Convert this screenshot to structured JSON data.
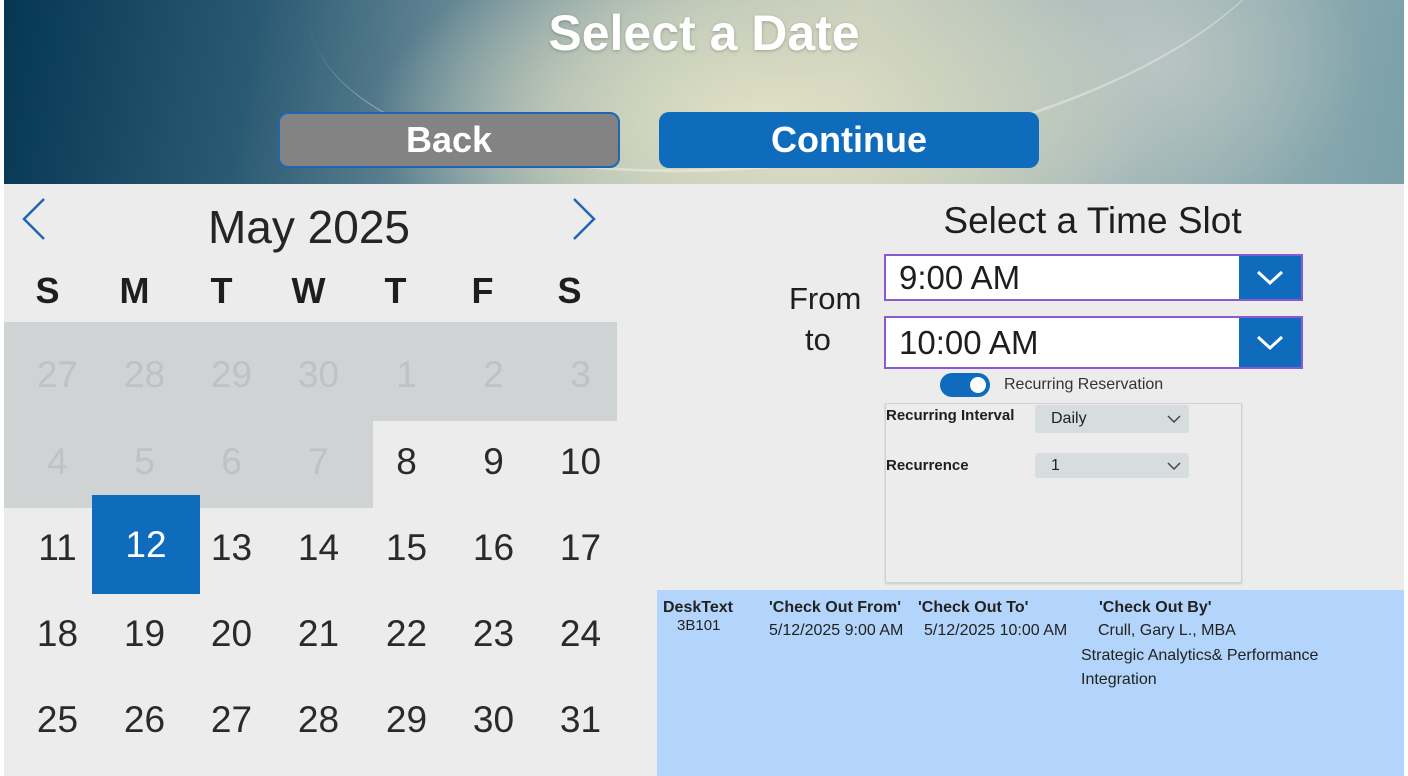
{
  "header": {
    "title": "Select a Date",
    "back_label": "Back",
    "continue_label": "Continue"
  },
  "calendar": {
    "month_label": "May 2025",
    "weekdays": [
      "S",
      "M",
      "T",
      "W",
      "T",
      "F",
      "S"
    ],
    "weeks": [
      [
        "27",
        "28",
        "29",
        "30",
        "1",
        "2",
        "3"
      ],
      [
        "4",
        "5",
        "6",
        "7",
        "8",
        "9",
        "10"
      ],
      [
        "11",
        "12",
        "13",
        "14",
        "15",
        "16",
        "17"
      ],
      [
        "18",
        "19",
        "20",
        "21",
        "22",
        "23",
        "24"
      ],
      [
        "25",
        "26",
        "27",
        "28",
        "29",
        "30",
        "31"
      ]
    ],
    "selected_day": "12"
  },
  "time_slot": {
    "title": "Select a Time Slot",
    "from_label": "From",
    "to_label": "to",
    "from_value": "9:00 AM",
    "to_value": "10:00 AM",
    "recurring_label": "Recurring Reservation",
    "recurring_interval_label": "Recurring Interval",
    "recurring_interval_value": "Daily",
    "recurrence_label": "Recurrence",
    "recurrence_value": "1"
  },
  "results": {
    "desk_header": "DeskText",
    "desk_value": "3B101",
    "from_header": "'Check Out From'",
    "from_value": "5/12/2025 9:00 AM",
    "to_header": "'Check Out To'",
    "to_value": "5/12/2025 10:00 AM",
    "by_header": "'Check Out By'",
    "by_name": "Crull, Gary L., MBA",
    "by_dept_line1": "Strategic Analytics& Performance",
    "by_dept_line2": "Integration"
  },
  "colors": {
    "accent": "#0f6cbd",
    "back_button": "#838383",
    "muted_block": "#cfd3d3",
    "results_bg": "#b4d5fb",
    "dropdown_border": "#8a5ad0"
  },
  "icons": {
    "prev": "chevron-left-icon",
    "next": "chevron-right-icon",
    "dropdown": "chevron-down-icon"
  }
}
